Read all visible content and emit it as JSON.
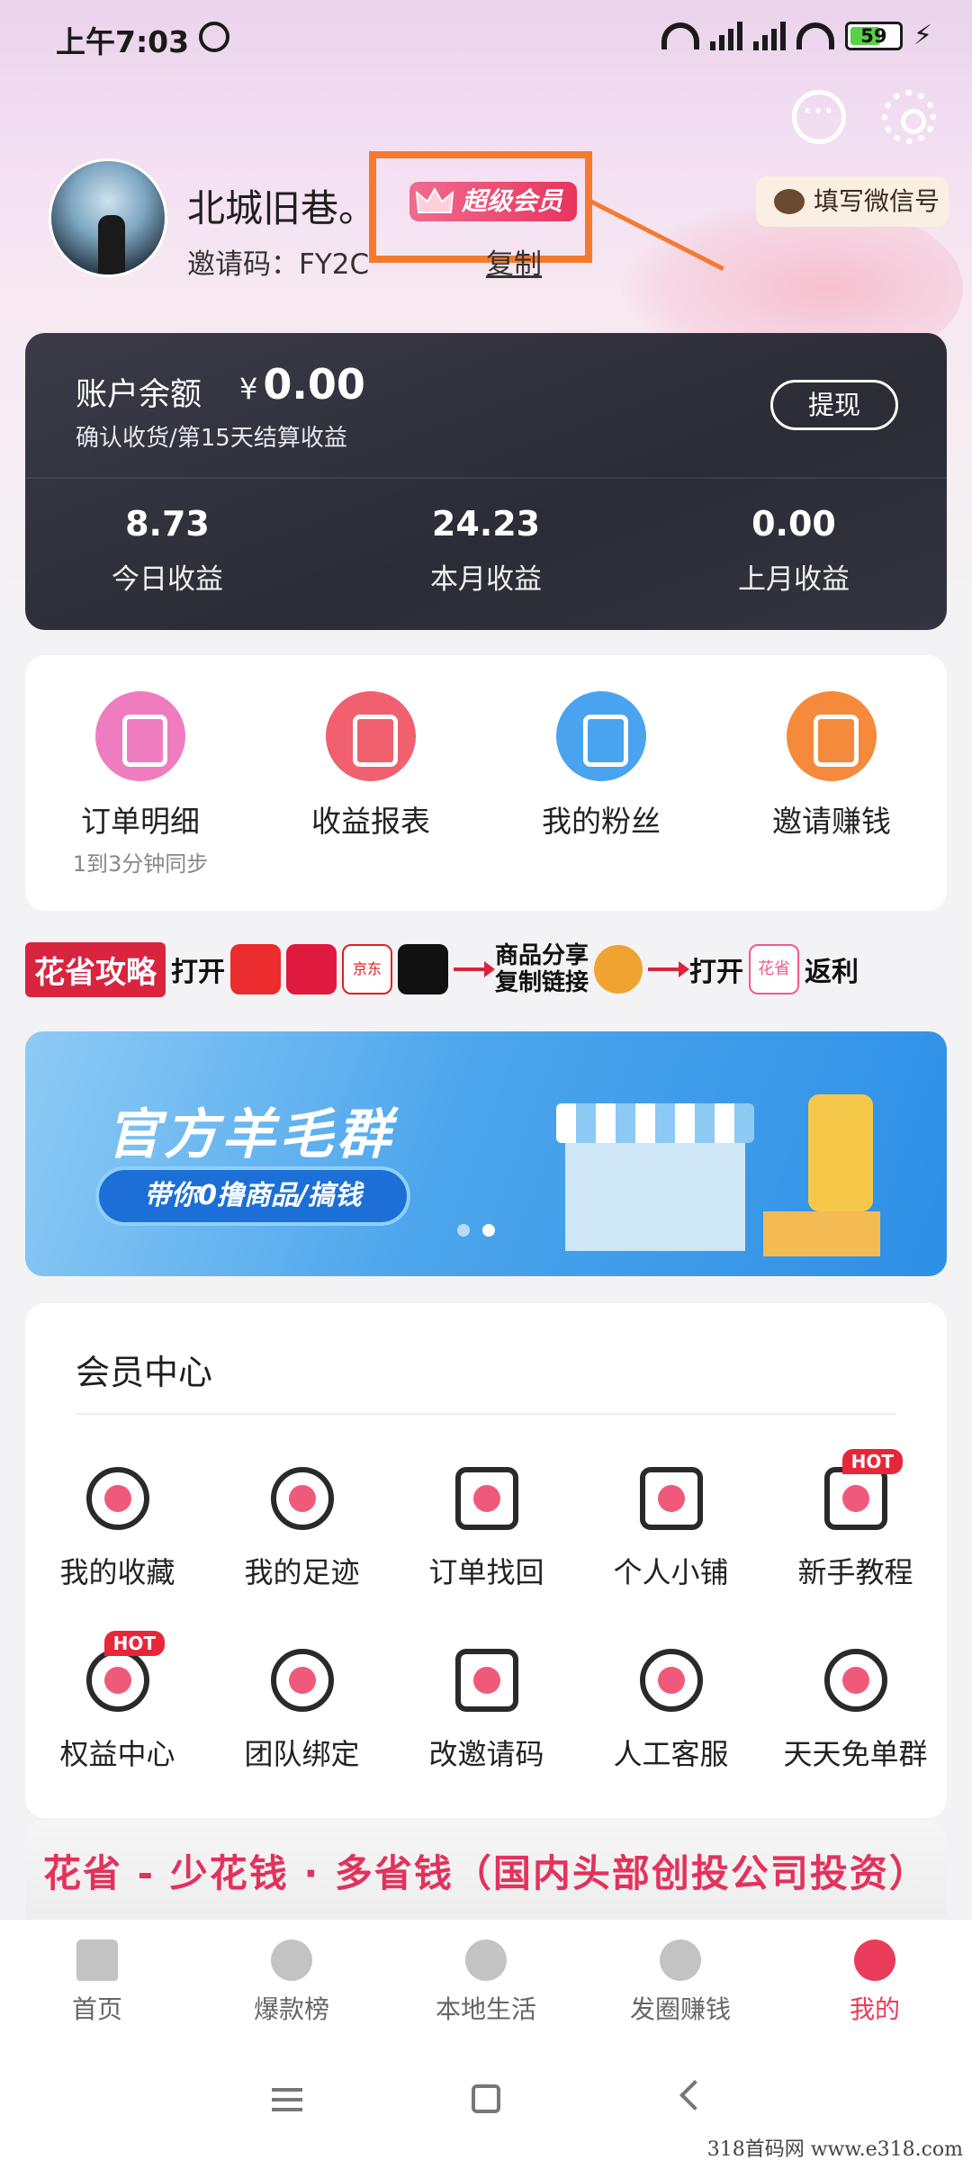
{
  "status_bar": {
    "time": "上午7:03",
    "battery": "59"
  },
  "profile": {
    "nickname": "北城旧巷。",
    "vip_label": "超级会员",
    "invite_code": "邀请码：FY2C",
    "copy_label": "复制",
    "wechat_button": "填写微信号"
  },
  "balance": {
    "label": "账户余额",
    "currency": "¥",
    "amount": "0.00",
    "note": "确认收货/第15天结算收益",
    "withdraw_label": "提现",
    "stats": [
      {
        "value": "8.73",
        "label": "今日收益"
      },
      {
        "value": "24.23",
        "label": "本月收益"
      },
      {
        "value": "0.00",
        "label": "上月收益"
      }
    ]
  },
  "shortcuts": [
    {
      "label": "订单明细",
      "sub": "1到3分钟同步",
      "icon": "clipboard-icon",
      "color": "#f07cc0"
    },
    {
      "label": "收益报表",
      "sub": "",
      "icon": "yen-ticket-icon",
      "color": "#f0606e"
    },
    {
      "label": "我的粉丝",
      "sub": "",
      "icon": "user-card-icon",
      "color": "#4aa3ee"
    },
    {
      "label": "邀请赚钱",
      "sub": "",
      "icon": "gift-icon",
      "color": "#f58a3c"
    }
  ],
  "guide": {
    "tag": "花省攻略",
    "open1": "打开",
    "jd_label": "京东",
    "share": "商品分享\n复制链接",
    "open2": "打开",
    "app_name": "花省",
    "rebate": "返利"
  },
  "banner": {
    "title": "官方羊毛群",
    "pill": "带你0撸商品/搞钱"
  },
  "member_center": {
    "title": "会员中心",
    "hot_label": "HOT",
    "items": [
      {
        "label": "我的收藏",
        "icon": "star-icon",
        "hot": false
      },
      {
        "label": "我的足迹",
        "icon": "clock-icon",
        "hot": false
      },
      {
        "label": "订单找回",
        "icon": "document-search-icon",
        "hot": false
      },
      {
        "label": "个人小铺",
        "icon": "shop-icon",
        "hot": false
      },
      {
        "label": "新手教程",
        "icon": "book-icon",
        "hot": true
      },
      {
        "label": "权益中心",
        "icon": "diamond-heart-icon",
        "hot": true
      },
      {
        "label": "团队绑定",
        "icon": "flower-icon",
        "hot": false
      },
      {
        "label": "改邀请码",
        "icon": "pencil-icon",
        "hot": false
      },
      {
        "label": "人工客服",
        "icon": "headphones-icon",
        "hot": false
      },
      {
        "label": "天天免单群",
        "icon": "heart-icon",
        "hot": false
      }
    ]
  },
  "slogan": "花省 - 少花钱 · 多省钱（国内头部创投公司投资）",
  "tabs": [
    {
      "label": "首页",
      "icon": "home-icon",
      "active": false
    },
    {
      "label": "爆款榜",
      "icon": "flame-icon",
      "active": false
    },
    {
      "label": "本地生活",
      "icon": "map-pin-icon",
      "active": false
    },
    {
      "label": "发圈赚钱",
      "icon": "compass-icon",
      "active": false
    },
    {
      "label": "我的",
      "icon": "user-icon",
      "active": true
    }
  ],
  "watermark": "318首码网  www.e318.com",
  "colors": {
    "accent": "#ea3b5b",
    "annotation": "#f47a30",
    "card_dark": "#2f2f3a"
  }
}
